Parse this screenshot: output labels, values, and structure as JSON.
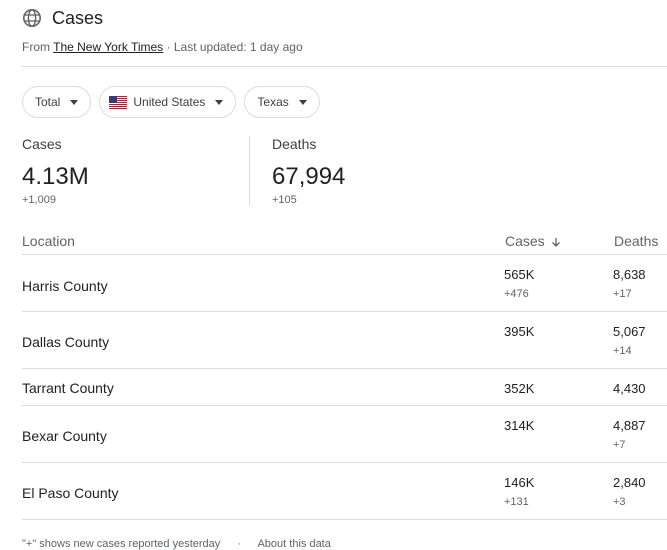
{
  "header": {
    "title": "Cases",
    "source_prefix": "From",
    "source_link": "The New York Times",
    "updated": "· Last updated: 1 day ago"
  },
  "filters": {
    "total": "Total",
    "country": "United States",
    "region": "Texas"
  },
  "stats": {
    "cases": {
      "label": "Cases",
      "value": "4.13M",
      "delta": "+1,009"
    },
    "deaths": {
      "label": "Deaths",
      "value": "67,994",
      "delta": "+105"
    }
  },
  "table": {
    "headers": {
      "location": "Location",
      "cases": "Cases",
      "deaths": "Deaths"
    },
    "rows": [
      {
        "location": "Harris County",
        "cases": "565K",
        "cases_delta": "+476",
        "deaths": "8,638",
        "deaths_delta": "+17"
      },
      {
        "location": "Dallas County",
        "cases": "395K",
        "cases_delta": "",
        "deaths": "5,067",
        "deaths_delta": "+14"
      },
      {
        "location": "Tarrant County",
        "cases": "352K",
        "cases_delta": "",
        "deaths": "4,430",
        "deaths_delta": ""
      },
      {
        "location": "Bexar County",
        "cases": "314K",
        "cases_delta": "",
        "deaths": "4,887",
        "deaths_delta": "+7"
      },
      {
        "location": "El Paso County",
        "cases": "146K",
        "cases_delta": "+131",
        "deaths": "2,840",
        "deaths_delta": "+3"
      }
    ]
  },
  "footer": {
    "note": "\"+\" shows new cases reported yesterday",
    "about": "About this data"
  },
  "icons": {
    "title": "globe-icon",
    "sort": "arrow-down-icon",
    "flag": "us-flag-icon"
  },
  "colors": {
    "border": "#dadce0",
    "text": "#202124",
    "muted": "#5f6368"
  }
}
